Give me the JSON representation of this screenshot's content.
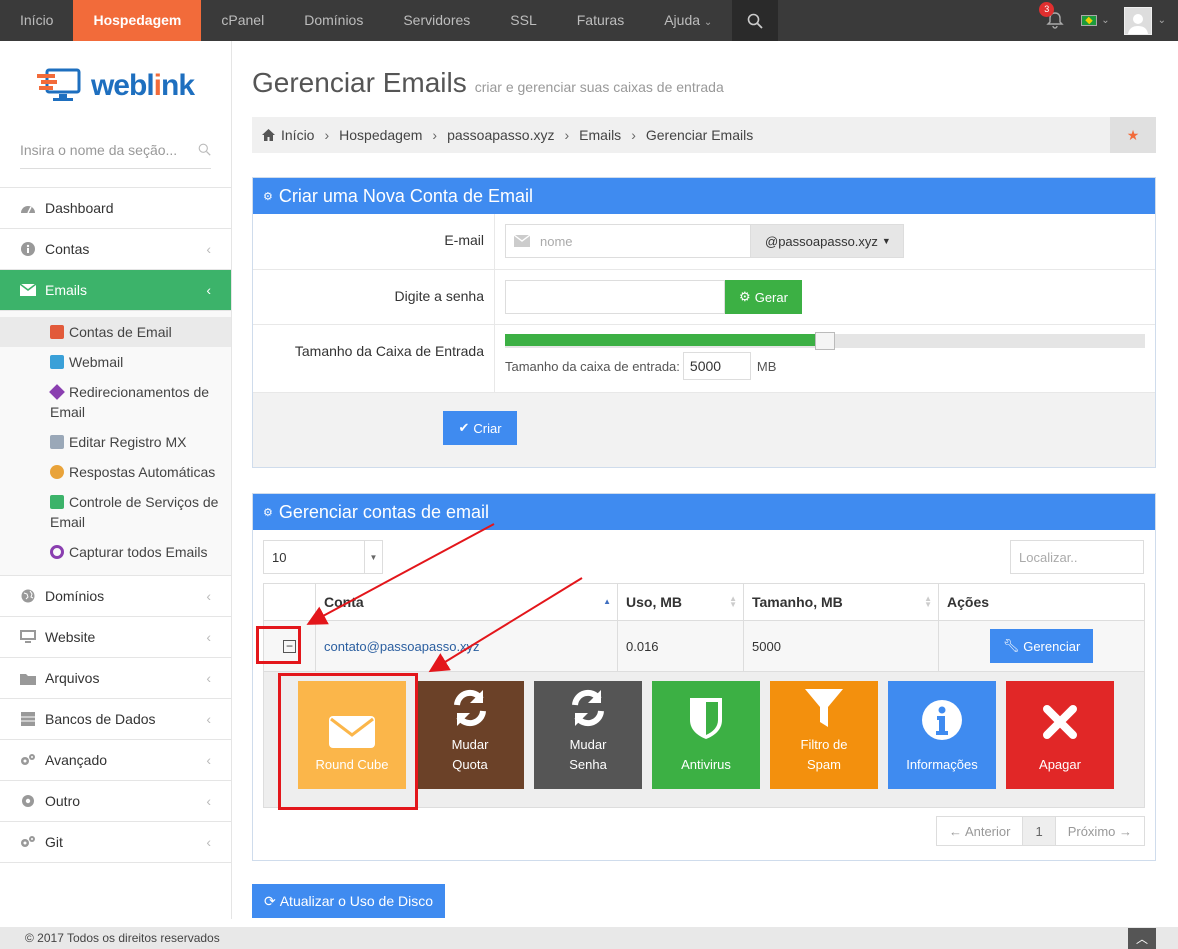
{
  "nav": {
    "items": [
      "Início",
      "Hospedagem",
      "cPanel",
      "Domínios",
      "Servidores",
      "SSL",
      "Faturas",
      "Ajuda"
    ],
    "active": "Hospedagem",
    "notifications": "3",
    "accent": "#f26b3a"
  },
  "sidebar": {
    "logo": {
      "text1": "webl",
      "text2": "i",
      "text3": "nk"
    },
    "search_placeholder": "Insira o nome da seção...",
    "menu": [
      {
        "label": "Dashboard",
        "icon": "dashboard-icon"
      },
      {
        "label": "Contas",
        "icon": "info-icon"
      },
      {
        "label": "Emails",
        "icon": "envelope-icon"
      },
      {
        "label": "Domínios",
        "icon": "globe-icon"
      },
      {
        "label": "Website",
        "icon": "monitor-icon"
      },
      {
        "label": "Arquivos",
        "icon": "folder-icon"
      },
      {
        "label": "Bancos de Dados",
        "icon": "database-icon"
      },
      {
        "label": "Avançado",
        "icon": "gears-icon"
      },
      {
        "label": "Outro",
        "icon": "gear-icon"
      },
      {
        "label": "Git",
        "icon": "gears-icon"
      }
    ],
    "emails_sub": [
      "Contas de Email",
      "Webmail",
      "Redirecionamentos de Email",
      "Editar Registro MX",
      "Respostas Automáticas",
      "Controle de Serviços de Email",
      "Capturar todos Emails"
    ]
  },
  "page": {
    "title": "Gerenciar Emails",
    "subtitle": "criar e gerenciar suas caixas de entrada",
    "breadcrumb": [
      "Início",
      "Hospedagem",
      "passoapasso.xyz",
      "Emails",
      "Gerenciar Emails"
    ]
  },
  "create": {
    "header": "Criar uma Nova Conta de Email",
    "email_label": "E-mail",
    "email_placeholder": "nome",
    "domain": "@passoapasso.xyz",
    "password_label": "Digite a senha",
    "generate": "Gerar",
    "size_label": "Tamanho da Caixa de Entrada",
    "size_sub_label": "Tamanho da caixa de entrada:",
    "size_value": "5000",
    "size_unit": "MB",
    "slider_fraction": 0.5,
    "create": "Criar"
  },
  "manage": {
    "header": "Gerenciar contas de email",
    "page_size": "10",
    "search_placeholder": "Localizar..",
    "columns": [
      "Conta",
      "Uso, MB",
      "Tamanho, MB",
      "Ações"
    ],
    "row": {
      "account": "contato@passoapasso.xyz",
      "usage": "0.016",
      "size": "5000",
      "action": "Gerenciar"
    },
    "tiles": [
      {
        "label": "Round Cube",
        "color": "#fbb64a",
        "icon": "envelope-icon"
      },
      {
        "label": "Mudar Quota",
        "color": "#6b4128",
        "icon": "refresh-icon"
      },
      {
        "label": "Mudar Senha",
        "color": "#555555",
        "icon": "refresh-icon"
      },
      {
        "label": "Antivirus",
        "color": "#3cb044",
        "icon": "shield-icon"
      },
      {
        "label": "Filtro de Spam",
        "color": "#f3900d",
        "icon": "filter-icon"
      },
      {
        "label": "Informações",
        "color": "#3f8bf0",
        "icon": "info-icon"
      },
      {
        "label": "Apagar",
        "color": "#e12727",
        "icon": "close-icon"
      }
    ],
    "pager": {
      "prev": "← Anterior",
      "page": "1",
      "next": "Próximo →"
    }
  },
  "disk_button": "Atualizar o Uso de Disco",
  "footer": "© 2017 Todos os direitos reservados"
}
